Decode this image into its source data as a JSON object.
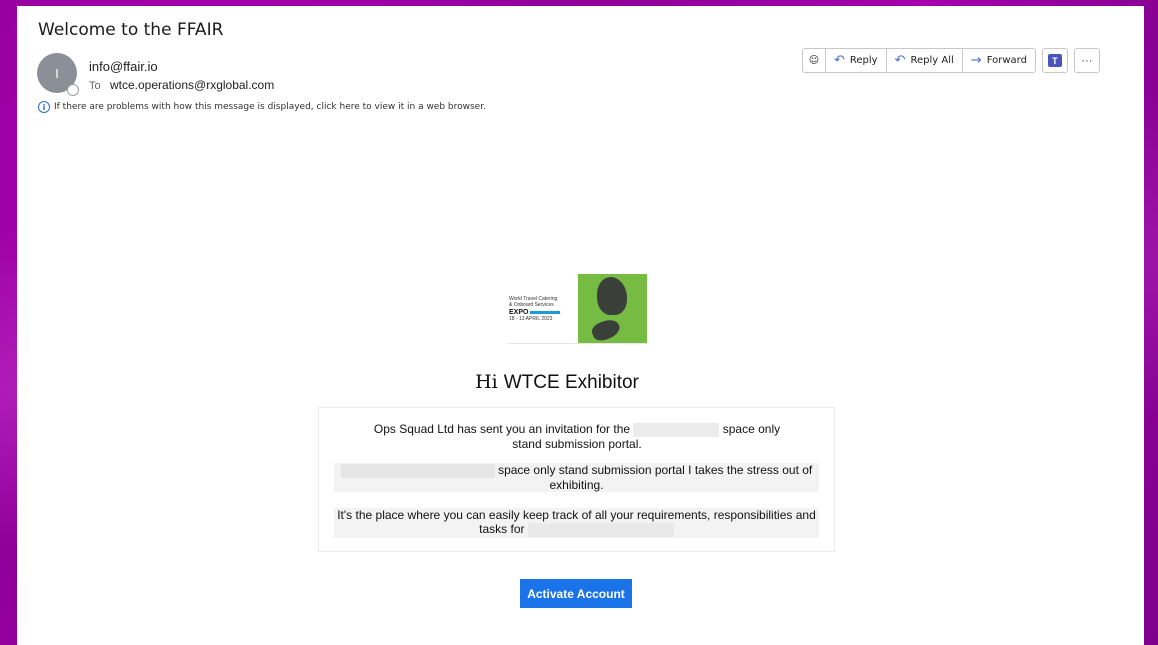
{
  "message": {
    "subject": "Welcome to the FFAIR",
    "avatar_initial": "I",
    "from": "info@ffair.io",
    "to_label": "To",
    "to": "wtce.operations@rxglobal.com",
    "info_bar": "If there are problems with how this message is displayed, click here to view it in a web browser."
  },
  "toolbar": {
    "reply": "Reply",
    "reply_all": "Reply All",
    "forward": "Forward",
    "more": "···"
  },
  "logo": {
    "line1": "World Travel Catering",
    "line2": "& Onboard Services",
    "expo": "EXPO",
    "date": "18 - 13 APRIL 2023"
  },
  "body": {
    "greeting_hi": "Hi",
    "greeting_name": "WTCE Exhibitor",
    "p1_a": "Ops Squad Ltd has sent you an invitation for the",
    "p1_b": "space only",
    "p1_c": "stand submission portal.",
    "p2_a": "space only stand submission portal I takes the stress out of",
    "p2_b": "exhibiting.",
    "p3_a": "It's the place where you can easily keep track of all your requirements, responsibilities and",
    "p3_b": "tasks for",
    "cta": "Activate Account"
  },
  "colors": {
    "cta": "#1a73e8",
    "background": "#9a00a6",
    "logo_green": "#76bc43"
  }
}
